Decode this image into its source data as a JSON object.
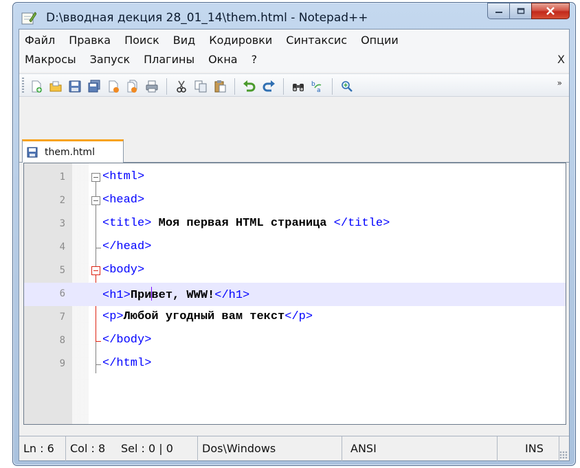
{
  "window": {
    "title": "D:\\вводная декция 28_01_14\\them.html - Notepad++"
  },
  "menu": {
    "row1": [
      {
        "label": "Файл"
      },
      {
        "label": "Правка"
      },
      {
        "label": "Поиск"
      },
      {
        "label": "Вид"
      },
      {
        "label": "Кодировки"
      },
      {
        "label": "Синтаксис"
      },
      {
        "label": "Опции"
      }
    ],
    "row2": [
      {
        "label": "Макросы"
      },
      {
        "label": "Запуск"
      },
      {
        "label": "Плагины"
      },
      {
        "label": "Окна"
      },
      {
        "label": "?"
      }
    ],
    "close_label": "X"
  },
  "toolbar": {
    "icons": [
      "new-file-icon",
      "open-file-icon",
      "save-icon",
      "save-all-icon",
      "close-icon",
      "close-all-icon",
      "print-icon",
      "cut-icon",
      "copy-icon",
      "paste-icon",
      "undo-icon",
      "redo-icon",
      "find-icon",
      "replace-icon",
      "zoom-in-icon"
    ],
    "overflow_label": "»"
  },
  "tabs": [
    {
      "label": "them.html",
      "active": true
    }
  ],
  "editor": {
    "current_line": 6,
    "lines": [
      {
        "num": "1",
        "tokens": [
          {
            "t": "tag",
            "v": "<html>"
          }
        ]
      },
      {
        "num": "2",
        "tokens": [
          {
            "t": "tag",
            "v": "<head>"
          }
        ]
      },
      {
        "num": "3",
        "tokens": [
          {
            "t": "tag",
            "v": "<title>"
          },
          {
            "t": "txt",
            "v": " Моя первая HTML страница "
          },
          {
            "t": "tag",
            "v": "</title>"
          }
        ]
      },
      {
        "num": "4",
        "tokens": [
          {
            "t": "tag",
            "v": "</head>"
          }
        ]
      },
      {
        "num": "5",
        "tokens": [
          {
            "t": "tag",
            "v": "<body>"
          }
        ]
      },
      {
        "num": "6",
        "tokens": [
          {
            "t": "tag",
            "v": "<h1>"
          },
          {
            "t": "txt",
            "v": "При"
          },
          {
            "t": "caret",
            "v": ""
          },
          {
            "t": "txt",
            "v": "вет, WWW!"
          },
          {
            "t": "tag",
            "v": "</h1>"
          }
        ]
      },
      {
        "num": "7",
        "tokens": [
          {
            "t": "tag",
            "v": "<p>"
          },
          {
            "t": "txt",
            "v": "Любой угодный вам текст"
          },
          {
            "t": "tag",
            "v": "</p>"
          }
        ]
      },
      {
        "num": "8",
        "tokens": [
          {
            "t": "tag",
            "v": "</body>"
          }
        ]
      },
      {
        "num": "9",
        "tokens": [
          {
            "t": "tag",
            "v": "</html>"
          }
        ]
      }
    ]
  },
  "status": {
    "ln": "Ln : 6",
    "col": "Col : 8",
    "sel": "Sel : 0 | 0",
    "eol": "Dos\\Windows",
    "encoding": "ANSI",
    "mode": "INS"
  },
  "colors": {
    "tag": "#0000ff",
    "text": "#000000",
    "current_line": "#e8e8ff",
    "tab_accent": "#f7a21c",
    "fold_active": "#dd2211"
  }
}
